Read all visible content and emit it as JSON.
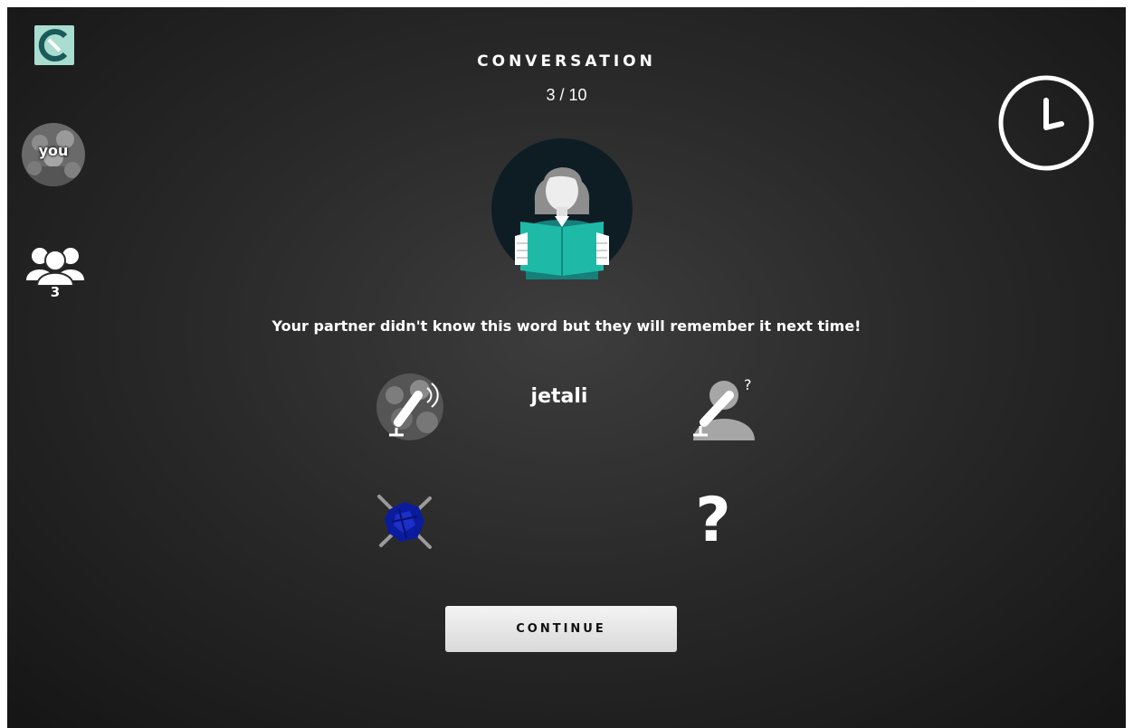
{
  "header": {
    "title": "CONVERSATION",
    "progress": "3 / 10"
  },
  "sidebar": {
    "logo_icon": "app-logo-icon",
    "you_label": "you",
    "players_icon": "group-icon",
    "players_count": "3"
  },
  "timer": {
    "icon": "clock-icon"
  },
  "partner": {
    "icon": "woman-reading-book-icon"
  },
  "result": {
    "message": "Your partner didn't know this word but they will remember it next time!",
    "word": "jetali",
    "speaker_icon": "speaking-microphone-icon",
    "listener_icon": "listener-question-icon",
    "shape_icon": "blue-shape-icon",
    "unknown_symbol": "?"
  },
  "actions": {
    "continue_label": "CONTINUE"
  },
  "colors": {
    "background": "#2a2a2a",
    "accent_teal": "#1fb9a8",
    "shape_blue": "#0b1b9e",
    "button": "#e8e8e8"
  }
}
